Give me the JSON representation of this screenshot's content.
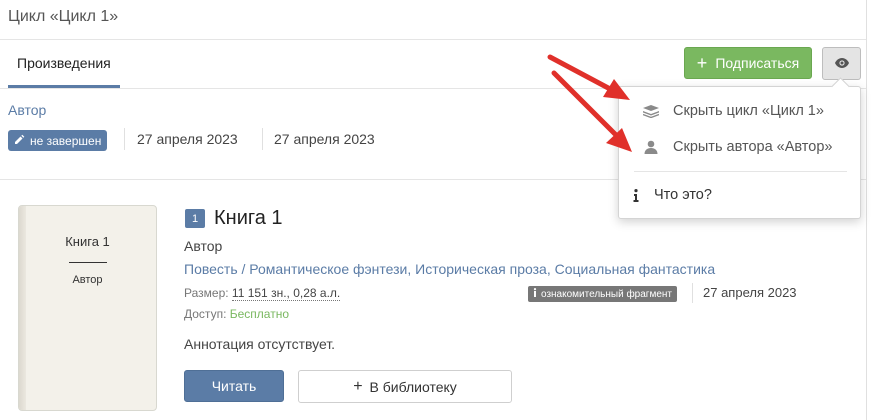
{
  "header": {
    "cycle_title": "Цикл «Цикл 1»"
  },
  "tabs": [
    {
      "label": "Произведения",
      "active": true
    }
  ],
  "actions": {
    "subscribe_label": "Подписаться",
    "subscribe_icon": "plus-icon",
    "visibility_icon": "eye-icon"
  },
  "cycle_meta": {
    "author": "Автор",
    "status": "не завершен",
    "status_icon": "pencil-icon",
    "date_started": "27 апреля 2023",
    "date_updated": "27 апреля 2023"
  },
  "dropdown": {
    "items": [
      {
        "label": "Скрыть цикл «Цикл 1»",
        "icon": "stack-icon"
      },
      {
        "label": "Скрыть автора «Автор»",
        "icon": "user-icon"
      },
      {
        "label": "Что это?",
        "icon": "info-icon"
      }
    ]
  },
  "book": {
    "number": "1",
    "title": "Книга 1",
    "author": "Автор",
    "cover_title": "Книга 1",
    "cover_author": "Автор",
    "form": "Повесть",
    "genres": [
      "Романтическое фэнтези",
      "Историческая проза",
      "Социальная фантастика"
    ],
    "size_label": "Размер:",
    "size_value": "11 151 зн., 0,28 а.л.",
    "access_label": "Доступ:",
    "access_value": "Бесплатно",
    "fragment_badge": "ознакомительный фрагмент",
    "date": "27 апреля 2023",
    "annotation": "Аннотация отсутствует.",
    "read_label": "Читать",
    "library_label": "В библиотеку"
  },
  "colors": {
    "accent": "#5b7ca6",
    "subscribe": "#7ab860",
    "free": "#7ab860",
    "arrow": "#e0302a"
  }
}
